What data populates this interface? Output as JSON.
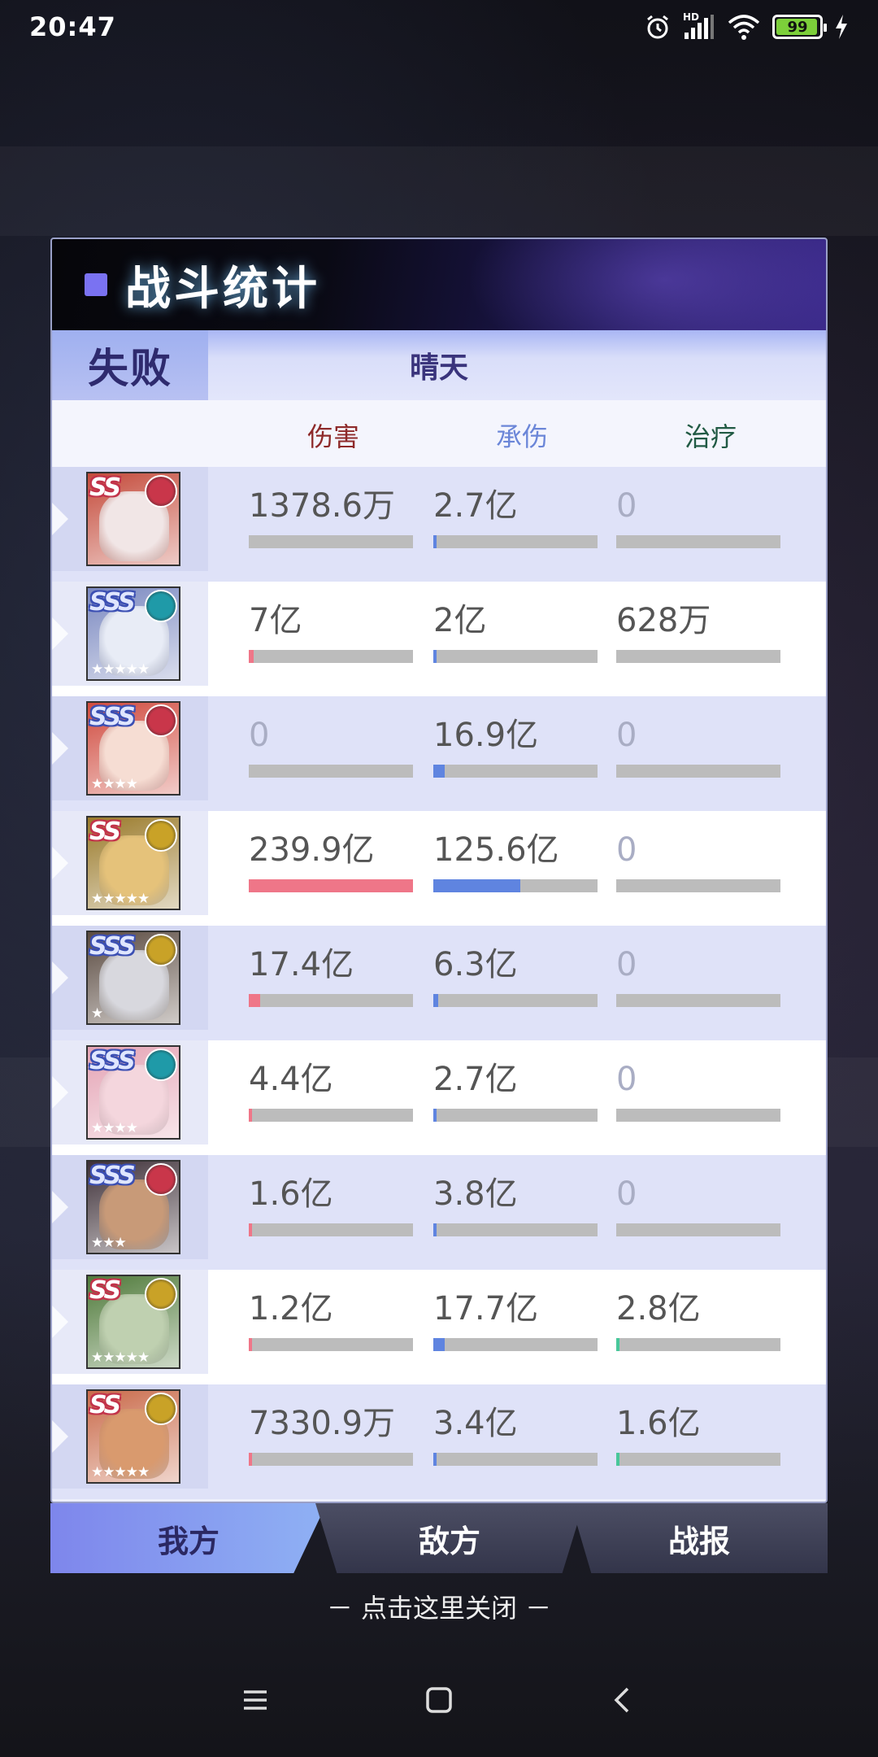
{
  "status_bar": {
    "time": "20:47",
    "network_label": "HD",
    "battery": "99"
  },
  "panel": {
    "title": "战斗统计",
    "result": "失败",
    "weather": "晴天",
    "columns": {
      "damage": "伤害",
      "tank": "承伤",
      "heal": "治疗"
    }
  },
  "heroes": [
    {
      "grade": "SS",
      "faction_color": "#c9364a",
      "face_color": "#f1e6e6",
      "bg": "#c44a3a",
      "stars": "",
      "damage": "1378.6万",
      "damage_pct": 0.0,
      "tank": "2.7亿",
      "tank_pct": 0.015,
      "heal": "0",
      "heal_pct": 0.0
    },
    {
      "grade": "SSS",
      "faction_color": "#1f9aa8",
      "face_color": "#e8ecf6",
      "bg": "#7a88c0",
      "stars": "★★★★★",
      "damage": "7亿",
      "damage_pct": 0.03,
      "tank": "2亿",
      "tank_pct": 0.01,
      "heal": "628万",
      "heal_pct": 0.0
    },
    {
      "grade": "SSS",
      "faction_color": "#c9364a",
      "face_color": "#f6ddd3",
      "bg": "#d04a3e",
      "stars": "★★★★",
      "damage": "0",
      "damage_pct": 0.0,
      "tank": "16.9亿",
      "tank_pct": 0.07,
      "heal": "0",
      "heal_pct": 0.0
    },
    {
      "grade": "SS",
      "faction_color": "#c9a227",
      "face_color": "#e5c27a",
      "bg": "#9a7a2a",
      "stars": "★★★★★",
      "damage": "239.9亿",
      "damage_pct": 1.0,
      "tank": "125.6亿",
      "tank_pct": 0.53,
      "heal": "0",
      "heal_pct": 0.0
    },
    {
      "grade": "SSS",
      "faction_color": "#c9a227",
      "face_color": "#d8d8de",
      "bg": "#5a4a40",
      "stars": "★",
      "damage": "17.4亿",
      "damage_pct": 0.07,
      "tank": "6.3亿",
      "tank_pct": 0.03,
      "heal": "0",
      "heal_pct": 0.0
    },
    {
      "grade": "SSS",
      "faction_color": "#1f9aa8",
      "face_color": "#f4d6dd",
      "bg": "#e4a3b4",
      "stars": "★★★★",
      "damage": "4.4亿",
      "damage_pct": 0.02,
      "tank": "2.7亿",
      "tank_pct": 0.015,
      "heal": "0",
      "heal_pct": 0.0
    },
    {
      "grade": "SSS",
      "faction_color": "#c9364a",
      "face_color": "#c89a78",
      "bg": "#3e3038",
      "stars": "★★★",
      "damage": "1.6亿",
      "damage_pct": 0.01,
      "tank": "3.8亿",
      "tank_pct": 0.015,
      "heal": "0",
      "heal_pct": 0.0
    },
    {
      "grade": "SS",
      "faction_color": "#c9a227",
      "face_color": "#bfd0b0",
      "bg": "#4f7a3a",
      "stars": "★★★★★",
      "damage": "1.2亿",
      "damage_pct": 0.005,
      "tank": "17.7亿",
      "tank_pct": 0.07,
      "heal": "2.8亿",
      "heal_pct": 0.01
    },
    {
      "grade": "SS",
      "faction_color": "#c9a227",
      "face_color": "#d99a6e",
      "bg": "#c96a4a",
      "stars": "★★★★★",
      "damage": "7330.9万",
      "damage_pct": 0.003,
      "tank": "3.4亿",
      "tank_pct": 0.015,
      "heal": "1.6亿",
      "heal_pct": 0.01
    }
  ],
  "tabs": {
    "ours": "我方",
    "enemy": "敌方",
    "report": "战报"
  },
  "close_hint": "－ 点击这里关闭 －"
}
